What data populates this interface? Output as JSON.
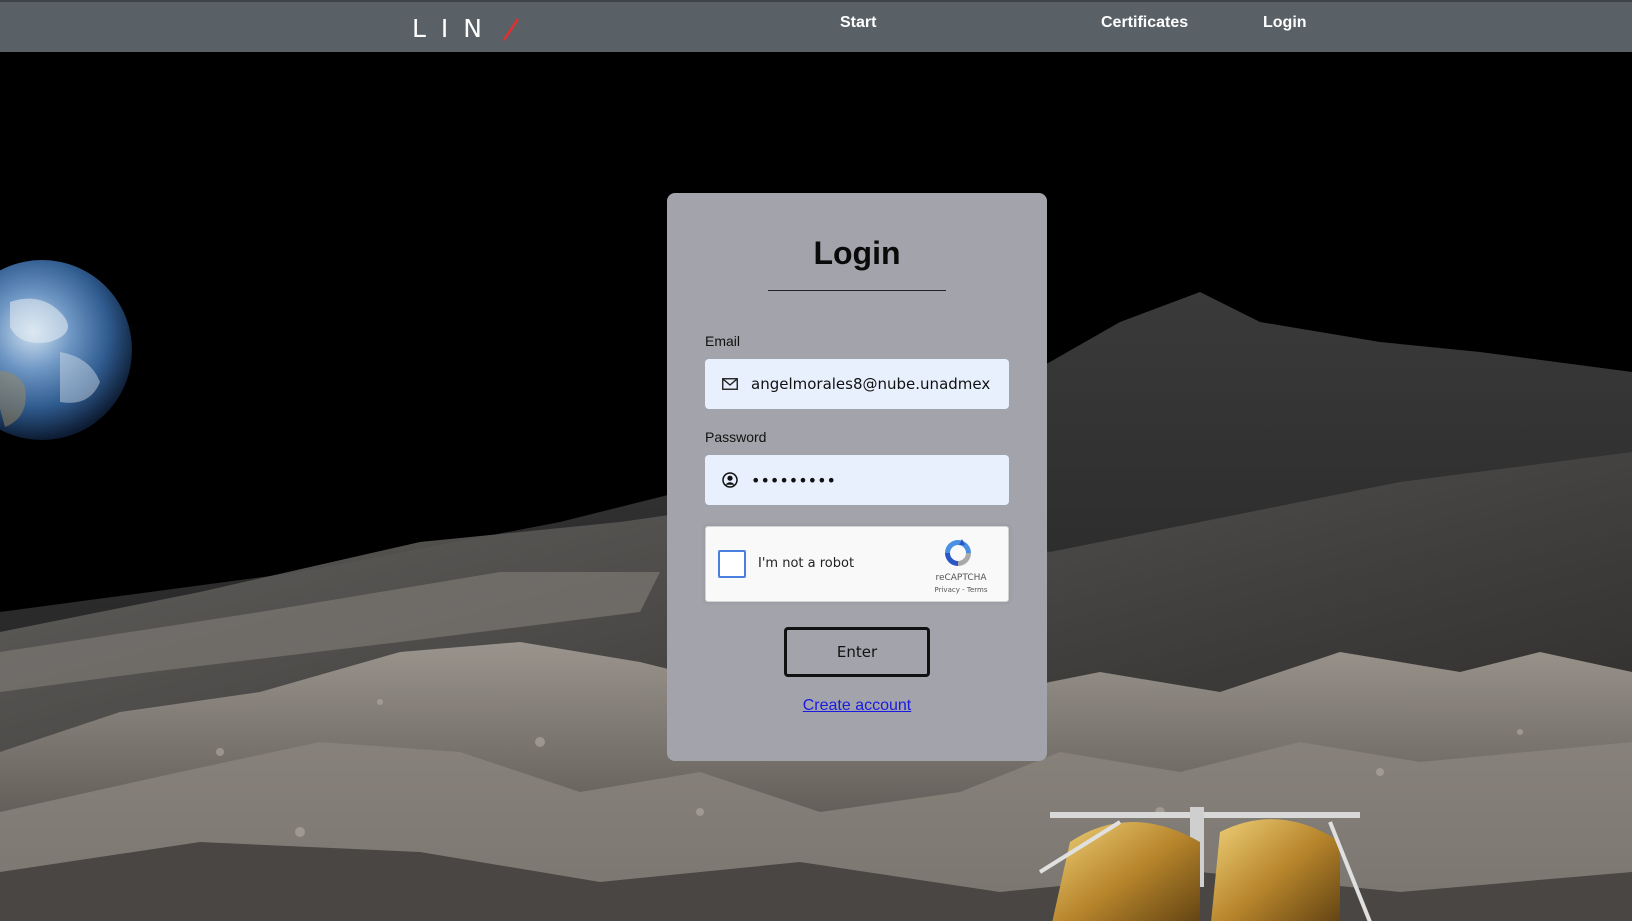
{
  "nav": {
    "logo_text": "LIN",
    "links": [
      "Start",
      "Certificates",
      "Login"
    ]
  },
  "login": {
    "title": "Login",
    "email_label": "Email",
    "email_value": "angelmorales8@nube.unadmex",
    "password_label": "Password",
    "password_value": "•••••••••",
    "captcha_label": "I'm not a robot",
    "captcha_brand": "reCAPTCHA",
    "captcha_privacy": "Privacy",
    "captcha_sep": " - ",
    "captcha_terms": "Terms",
    "captcha_checked": false,
    "submit_label": "Enter",
    "create_account": "Create account"
  },
  "colors": {
    "navbar": "#596066",
    "card": "#a3a4ab",
    "input_bg": "#e8f0fe",
    "logo_accent": "#e03030",
    "link": "#1a1ae0",
    "captcha_border": "#4a7fe0"
  },
  "icons": {
    "logo_slash": "red-slash",
    "email_field": "envelope-icon",
    "password_field": "user-circle-icon",
    "captcha": "recaptcha-logo-icon"
  }
}
